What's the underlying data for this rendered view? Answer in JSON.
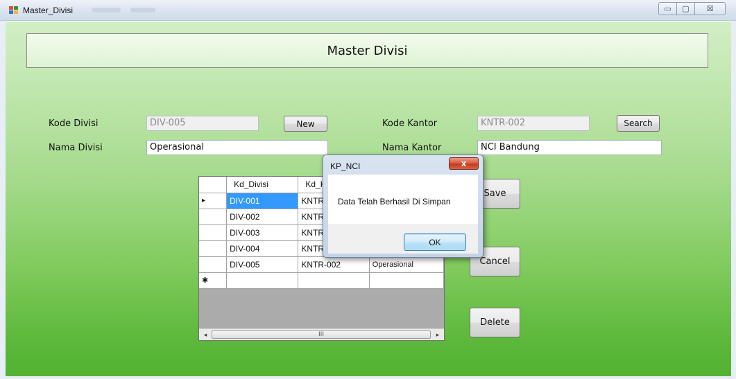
{
  "window": {
    "title": "Master_Divisi",
    "minimize_glyph": "▭",
    "maximize_glyph": "▢",
    "close_glyph": "☒"
  },
  "header": {
    "title": "Master Divisi"
  },
  "form": {
    "kode_divisi_label": "Kode Divisi",
    "kode_divisi_value": "DIV-005",
    "nama_divisi_label": "Nama Divisi",
    "nama_divisi_value": "Operasional",
    "kode_kantor_label": "Kode Kantor",
    "kode_kantor_value": "KNTR-002",
    "nama_kantor_label": "Nama Kantor",
    "nama_kantor_value": "NCI Bandung",
    "new_button": "New",
    "search_button": "Search",
    "save_button": "Save",
    "cancel_button": "Cancel",
    "delete_button": "Delete"
  },
  "grid": {
    "columns": [
      "Kd_Divisi",
      "Kd_K",
      ""
    ],
    "current_row_marker": "▸",
    "new_row_marker": "✱",
    "rows": [
      [
        "DIV-001",
        "KNTR",
        ""
      ],
      [
        "DIV-002",
        "KNTR",
        ""
      ],
      [
        "DIV-003",
        "KNTR",
        ""
      ],
      [
        "DIV-004",
        "KNTR",
        ""
      ],
      [
        "DIV-005",
        "KNTR-002",
        "Operasional"
      ]
    ],
    "scroll_left": "◂",
    "scroll_right": "▸",
    "scroll_grip": "III"
  },
  "dialog": {
    "title": "KP_NCI",
    "close_glyph": "x",
    "message": "Data Telah Berhasil Di Simpan",
    "ok_button": "OK"
  }
}
